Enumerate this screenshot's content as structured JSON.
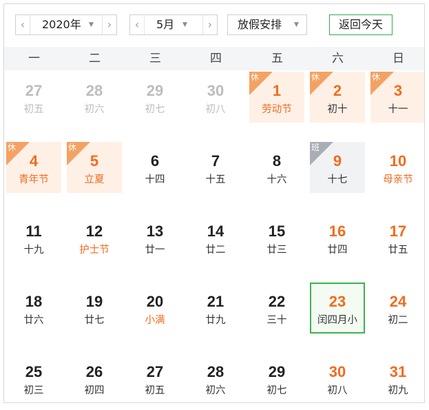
{
  "toolbar": {
    "year_value": "2020年",
    "month_value": "5月",
    "holiday_select": "放假安排",
    "today_button": "返回今天",
    "prev_arrow": "‹",
    "next_arrow": "›",
    "caret": "▼"
  },
  "weekdays": [
    "一",
    "二",
    "三",
    "四",
    "五",
    "六",
    "日"
  ],
  "days": [
    {
      "day": "27",
      "lunar": "初五",
      "state": "dim"
    },
    {
      "day": "28",
      "lunar": "初六",
      "state": "dim"
    },
    {
      "day": "29",
      "lunar": "初七",
      "state": "dim"
    },
    {
      "day": "30",
      "lunar": "初八",
      "state": "dim"
    },
    {
      "day": "1",
      "lunar": "劳动节",
      "tag": "休",
      "festive": true
    },
    {
      "day": "2",
      "lunar": "初十",
      "tag": "休",
      "weekend": true
    },
    {
      "day": "3",
      "lunar": "十一",
      "tag": "休",
      "weekend": true
    },
    {
      "day": "4",
      "lunar": "青年节",
      "tag": "休",
      "festive": true
    },
    {
      "day": "5",
      "lunar": "立夏",
      "tag": "休",
      "festive": true
    },
    {
      "day": "6",
      "lunar": "十四"
    },
    {
      "day": "7",
      "lunar": "十五"
    },
    {
      "day": "8",
      "lunar": "十六"
    },
    {
      "day": "9",
      "lunar": "十七",
      "tag": "班",
      "weekend": true
    },
    {
      "day": "10",
      "lunar": "母亲节",
      "weekend": true,
      "festive": true
    },
    {
      "day": "11",
      "lunar": "十九"
    },
    {
      "day": "12",
      "lunar": "护士节",
      "festive": true
    },
    {
      "day": "13",
      "lunar": "廿一"
    },
    {
      "day": "14",
      "lunar": "廿二"
    },
    {
      "day": "15",
      "lunar": "廿三"
    },
    {
      "day": "16",
      "lunar": "廿四",
      "weekend": true
    },
    {
      "day": "17",
      "lunar": "廿五",
      "weekend": true
    },
    {
      "day": "18",
      "lunar": "廿六"
    },
    {
      "day": "19",
      "lunar": "廿七"
    },
    {
      "day": "20",
      "lunar": "小满",
      "festive": true
    },
    {
      "day": "21",
      "lunar": "廿九"
    },
    {
      "day": "22",
      "lunar": "三十"
    },
    {
      "day": "23",
      "lunar": "闰四月小",
      "weekend": true,
      "today": true
    },
    {
      "day": "24",
      "lunar": "初二",
      "weekend": true
    },
    {
      "day": "25",
      "lunar": "初三"
    },
    {
      "day": "26",
      "lunar": "初四"
    },
    {
      "day": "27",
      "lunar": "初五"
    },
    {
      "day": "28",
      "lunar": "初六"
    },
    {
      "day": "29",
      "lunar": "初七"
    },
    {
      "day": "30",
      "lunar": "初八",
      "weekend": true
    },
    {
      "day": "31",
      "lunar": "初九",
      "weekend": true
    }
  ],
  "colors": {
    "holiday_tag": "#f4a263",
    "work_tag": "#a9aeb5",
    "holiday_bg": "#fff0e6",
    "accent_orange": "#f26b1d",
    "today_border": "#3bb34a"
  }
}
